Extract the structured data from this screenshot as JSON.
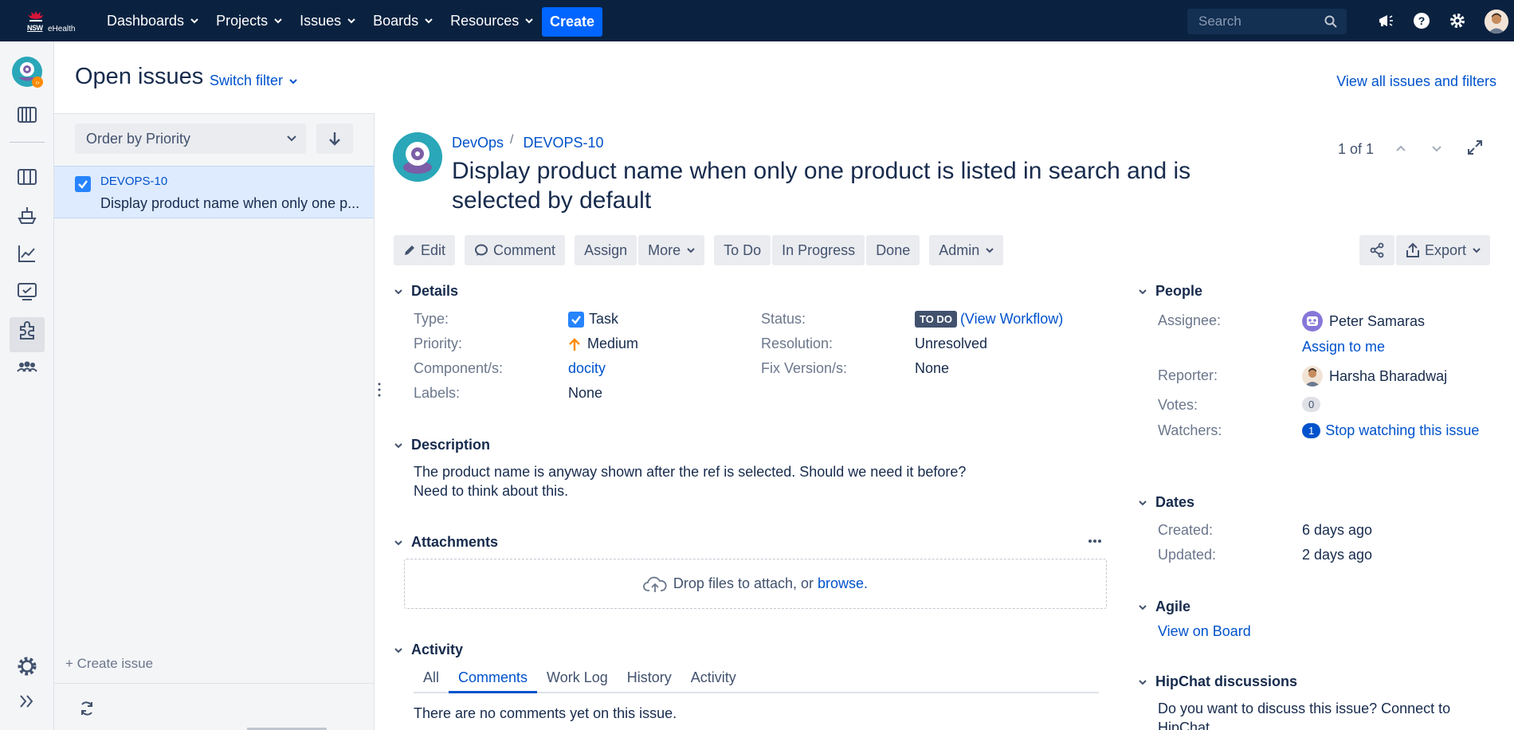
{
  "nav": {
    "logo_text": "NSW",
    "logo_sub": "eHealth",
    "items": [
      {
        "label": "Dashboards"
      },
      {
        "label": "Projects"
      },
      {
        "label": "Issues"
      },
      {
        "label": "Boards"
      },
      {
        "label": "Resources"
      }
    ],
    "create_label": "Create",
    "search_placeholder": "Search"
  },
  "header": {
    "title": "Open issues",
    "switch_filter": "Switch filter",
    "view_all": "View all issues and filters"
  },
  "list": {
    "order_label": "Order by Priority",
    "issues": [
      {
        "key": "DEVOPS-10",
        "summary": "Display product name when only one p..."
      }
    ],
    "create_issue": "+ Create issue"
  },
  "issue": {
    "project": "DevOps",
    "key": "DEVOPS-10",
    "title": "Display product name when only one product is listed in search and is selected by default",
    "pager": "1 of 1",
    "toolbar": {
      "edit": "Edit",
      "comment": "Comment",
      "assign": "Assign",
      "more": "More",
      "todo": "To Do",
      "in_progress": "In Progress",
      "done": "Done",
      "admin": "Admin",
      "export": "Export"
    },
    "details": {
      "heading": "Details",
      "type_label": "Type:",
      "type_value": "Task",
      "priority_label": "Priority:",
      "priority_value": "Medium",
      "component_label": "Component/s:",
      "component_value": "docity",
      "labels_label": "Labels:",
      "labels_value": "None",
      "status_label": "Status:",
      "status_value": "TO DO",
      "view_workflow": "(View Workflow)",
      "resolution_label": "Resolution:",
      "resolution_value": "Unresolved",
      "fix_label": "Fix Version/s:",
      "fix_value": "None"
    },
    "description": {
      "heading": "Description",
      "line1": "The product name is anyway shown after the ref is selected. Should we need it before?",
      "line2": "Need to think about this."
    },
    "attachments": {
      "heading": "Attachments",
      "drop_text": "Drop files to attach, or",
      "browse": "browse."
    },
    "activity": {
      "heading": "Activity",
      "tabs": [
        "All",
        "Comments",
        "Work Log",
        "History",
        "Activity"
      ],
      "empty": "There are no comments yet on this issue."
    }
  },
  "people": {
    "heading": "People",
    "assignee_label": "Assignee:",
    "assignee": "Peter Samaras",
    "assign_to_me": "Assign to me",
    "reporter_label": "Reporter:",
    "reporter": "Harsha Bharadwaj",
    "votes_label": "Votes:",
    "votes": "0",
    "watchers_label": "Watchers:",
    "watchers": "1",
    "stop_watching": "Stop watching this issue"
  },
  "dates": {
    "heading": "Dates",
    "created_label": "Created:",
    "created": "6 days ago",
    "updated_label": "Updated:",
    "updated": "2 days ago"
  },
  "agile": {
    "heading": "Agile",
    "view_on_board": "View on Board"
  },
  "hipchat": {
    "heading": "HipChat discussions",
    "text": "Do you want to discuss this issue? Connect to",
    "text2": "HipChat"
  },
  "colors": {
    "nav_bg": "#0a2240",
    "accent": "#0052cc",
    "create_btn": "#0065ff",
    "selected_row": "#deebff"
  }
}
